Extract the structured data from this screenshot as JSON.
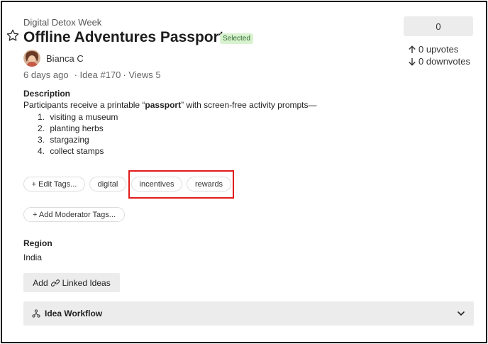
{
  "header": {
    "category": "Digital Detox Week",
    "title": "Offline Adventures Passport",
    "status_badge": "Selected"
  },
  "author": {
    "name": "Bianca C"
  },
  "meta": {
    "posted": "6 days ago",
    "idea_id": "· Idea #170",
    "views": "· Views 5"
  },
  "votes": {
    "score": "0",
    "upvotes": "0 upvotes",
    "downvotes": "0 downvotes"
  },
  "description": {
    "label": "Description",
    "intro_before": "Participants receive a printable “",
    "intro_bold": "passport",
    "intro_after": "” with screen-free activity prompts—",
    "items": [
      {
        "num": "1.",
        "text": "visiting a museum"
      },
      {
        "num": "2.",
        "text": "planting herbs"
      },
      {
        "num": "3.",
        "text": "stargazing"
      },
      {
        "num": "4.",
        "text": "collect stamps"
      }
    ]
  },
  "tags": {
    "edit_label": "+ Edit Tags...",
    "items": [
      "digital",
      "incentives",
      "rewards"
    ],
    "moderator_label": "+ Add Moderator Tags..."
  },
  "region": {
    "label": "Region",
    "value": "India"
  },
  "linked": {
    "label": "Add",
    "label2": "Linked Ideas"
  },
  "workflow": {
    "label": "Idea Workflow"
  },
  "colors": {
    "highlight": "#e11b1b",
    "badge_bg": "#d9f2cf",
    "badge_text": "#2f6b33"
  },
  "icons": [
    "star-icon",
    "arrow-up-icon",
    "arrow-down-icon",
    "link-icon",
    "workflow-icon",
    "chevron-down-icon"
  ]
}
